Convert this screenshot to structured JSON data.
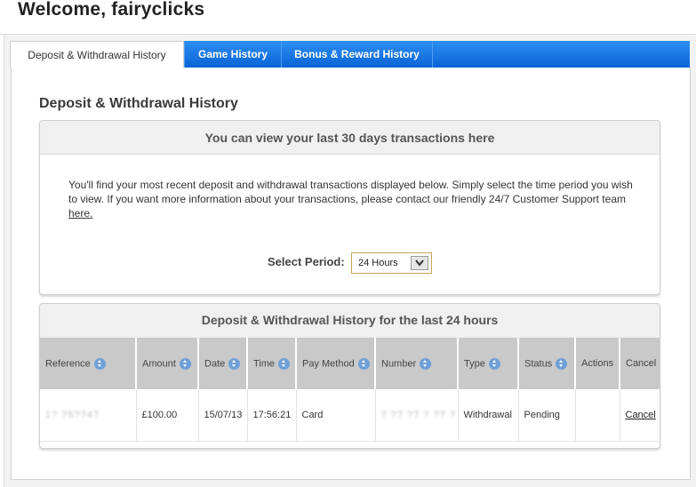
{
  "header": {
    "welcome": "Welcome, fairyclicks"
  },
  "tabs": [
    {
      "label": "Deposit & Withdrawal History",
      "active": true
    },
    {
      "label": "Game History",
      "active": false
    },
    {
      "label": "Bonus & Reward History",
      "active": false
    }
  ],
  "colors": {
    "tab_blue": "#1f7de6",
    "table_header_bg": "#c9c9c9",
    "sort_icon": "#6f9fd8"
  },
  "section_title": "Deposit & Withdrawal History",
  "info": {
    "heading": "You can view your last 30 days transactions here",
    "text": "You'll find your most recent deposit and withdrawal transactions displayed below. Simply select the time period you wish to view. If you want more information about your transactions, please contact our friendly 24/7 Customer Support team ",
    "link": "here.",
    "period_label": "Select Period:",
    "period_value": "24 Hours"
  },
  "history": {
    "heading": "Deposit & Withdrawal History for the last 24 hours",
    "columns": [
      "Reference",
      "Amount",
      "Date",
      "Time",
      "Pay Method",
      "Number",
      "Type",
      "Status",
      "Actions",
      "Cancel"
    ],
    "rows": [
      {
        "reference": "1? ?5??4?",
        "amount": "£100.00",
        "date": "15/07/13",
        "time": "17:56:21",
        "pay_method": "Card",
        "number": "? ?? ?? ? ?? ?",
        "type": "Withdrawal",
        "status": "Pending",
        "actions": "",
        "cancel": "Cancel"
      }
    ]
  }
}
